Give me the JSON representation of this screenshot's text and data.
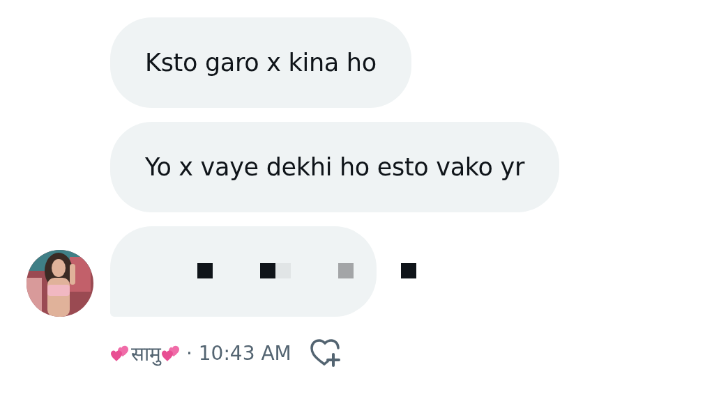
{
  "messages": [
    {
      "kind": "text",
      "text": "Ksto garo x kina ho"
    },
    {
      "kind": "text",
      "text": "Yo x vaye dekhi ho esto vako yr"
    },
    {
      "kind": "obscured",
      "groups": [
        {
          "blocks": [
            {
              "color": "#0f1419"
            }
          ]
        },
        {
          "blocks": [
            {
              "color": "#0f1419"
            },
            {
              "color": "#e1e5e6"
            }
          ]
        },
        {
          "blocks": [
            {
              "color": "#a3a5a7"
            }
          ]
        },
        {
          "blocks": [
            {
              "color": "#0f1419"
            }
          ]
        }
      ]
    }
  ],
  "footer": {
    "sender": "सामु",
    "time": "· 10:43 AM"
  }
}
